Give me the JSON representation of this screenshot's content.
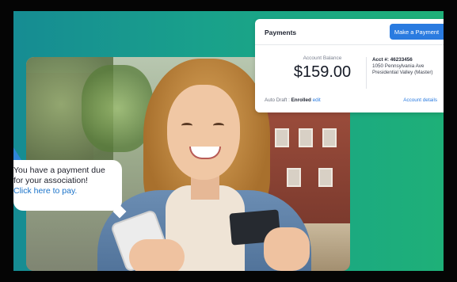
{
  "chat": {
    "line1": "You have a payment due",
    "line2": "for your association!",
    "link": "Click here to pay."
  },
  "payments": {
    "title": "Payments",
    "make_payment": "Make a Payment",
    "balance_label": "Account Balance",
    "balance": "$159.00",
    "acct_number": "Acct #: 46233456",
    "address1": "1050 Pennsylvania Ave",
    "address2": "Presidential Valley (Master)",
    "autodraft_label": "Auto Draft :",
    "autodraft_status": "Enrolled",
    "edit": "edit",
    "account_details": "Account details"
  },
  "colors": {
    "accent": "#2a7be0",
    "background_start": "#168c93",
    "background_end": "#1eb078"
  }
}
